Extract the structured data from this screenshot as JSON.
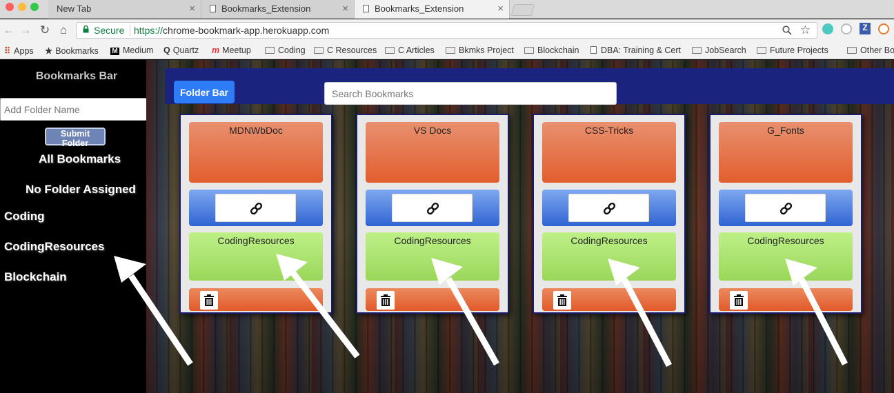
{
  "browser": {
    "tabs": [
      {
        "label": "New Tab"
      },
      {
        "label": "Bookmarks_Extension"
      },
      {
        "label": "Bookmarks_Extension"
      }
    ],
    "close_glyph": "×",
    "omnibox": {
      "secure_label": "Secure",
      "url_scheme": "https://",
      "url_host": "chrome-bookmark-app.herokuapp.com"
    },
    "bookmarks": [
      {
        "label": "Apps",
        "icon": "apps-grid-icon"
      },
      {
        "label": "Bookmarks",
        "icon": "star-icon"
      },
      {
        "label": "Medium",
        "icon": "medium-logo-icon"
      },
      {
        "label": "Quartz",
        "icon": "quartz-logo-icon"
      },
      {
        "label": "Meetup",
        "icon": "meetup-logo-icon"
      },
      {
        "label": "Coding",
        "icon": "folder-icon"
      },
      {
        "label": "C Resources",
        "icon": "folder-icon"
      },
      {
        "label": "C Articles",
        "icon": "folder-icon"
      },
      {
        "label": "Bkmks Project",
        "icon": "folder-icon"
      },
      {
        "label": "Blockchain",
        "icon": "folder-icon"
      },
      {
        "label": "DBA: Training & Cert",
        "icon": "page-icon"
      },
      {
        "label": "JobSearch",
        "icon": "folder-icon"
      },
      {
        "label": "Future Projects",
        "icon": "folder-icon"
      },
      {
        "label": "Other Bo",
        "icon": "folder-icon"
      }
    ]
  },
  "sidebar": {
    "title": "Bookmarks Bar",
    "folder_input_placeholder": "Add Folder Name",
    "submit_label": "Submit Folder",
    "all_bookmarks": "All Bookmarks",
    "no_folder": "No Folder Assigned",
    "folders": [
      "Coding",
      "CodingResources",
      "Blockchain"
    ]
  },
  "main": {
    "folder_bar_label": "Folder Bar",
    "search_placeholder": "Search Bookmarks",
    "cards": [
      {
        "title": "MDNWbDoc",
        "folder": "CodingResources"
      },
      {
        "title": "VS Docs",
        "folder": "CodingResources"
      },
      {
        "title": "CSS-Tricks",
        "folder": "CodingResources"
      },
      {
        "title": "G_Fonts",
        "folder": "CodingResources"
      }
    ]
  },
  "colors": {
    "title_box": "#e25e2d",
    "link_box": "#2f64d2",
    "folder_box": "#9ad75a",
    "topbar": "#1a237e",
    "folder_bar_button": "#2e7cf6"
  }
}
